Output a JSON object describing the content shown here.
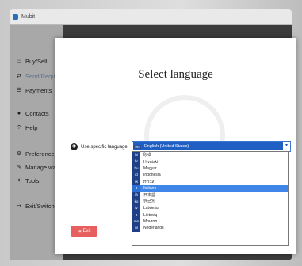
{
  "window": {
    "title": "Mubit"
  },
  "sidebar": {
    "items": [
      {
        "label": "Buy/Sell",
        "icon": "monitor-icon"
      },
      {
        "label": "Send/Request",
        "icon": "transfer-icon"
      },
      {
        "label": "Payments",
        "icon": "list-icon"
      },
      {
        "label": "Contacts",
        "icon": "user-icon"
      },
      {
        "label": "Help",
        "icon": "question-icon"
      },
      {
        "label": "Preferences",
        "icon": "gears-icon"
      },
      {
        "label": "Manage walle",
        "icon": "edit-icon"
      },
      {
        "label": "Tools",
        "icon": "wrench-icon"
      },
      {
        "label": "Exit/Switch",
        "icon": "exit-icon"
      }
    ]
  },
  "dialog": {
    "title": "Select language",
    "option_label": "Use specific language",
    "selected": {
      "code": "en",
      "name": "English (United States)"
    },
    "options": [
      {
        "code": "hi",
        "name": "हिन्दी"
      },
      {
        "code": "hr",
        "name": "Hrvatski"
      },
      {
        "code": "hu",
        "name": "Magyar"
      },
      {
        "code": "id",
        "name": "Indonesia"
      },
      {
        "code": "iw",
        "name": "עברית"
      },
      {
        "code": "it",
        "name": "Italiano",
        "highlighted": true
      },
      {
        "code": "ja",
        "name": "日本語"
      },
      {
        "code": "ko",
        "name": "한국어"
      },
      {
        "code": "lv",
        "name": "Latviešu"
      },
      {
        "code": "lt",
        "name": "Lietuvių"
      },
      {
        "code": "mn",
        "name": "Монгол"
      },
      {
        "code": "nl",
        "name": "Nederlands"
      }
    ],
    "exit_label": "Exit"
  },
  "colors": {
    "accent": "#1f5fc4",
    "highlight": "#3f86e8",
    "exit": "#e85f5f"
  }
}
